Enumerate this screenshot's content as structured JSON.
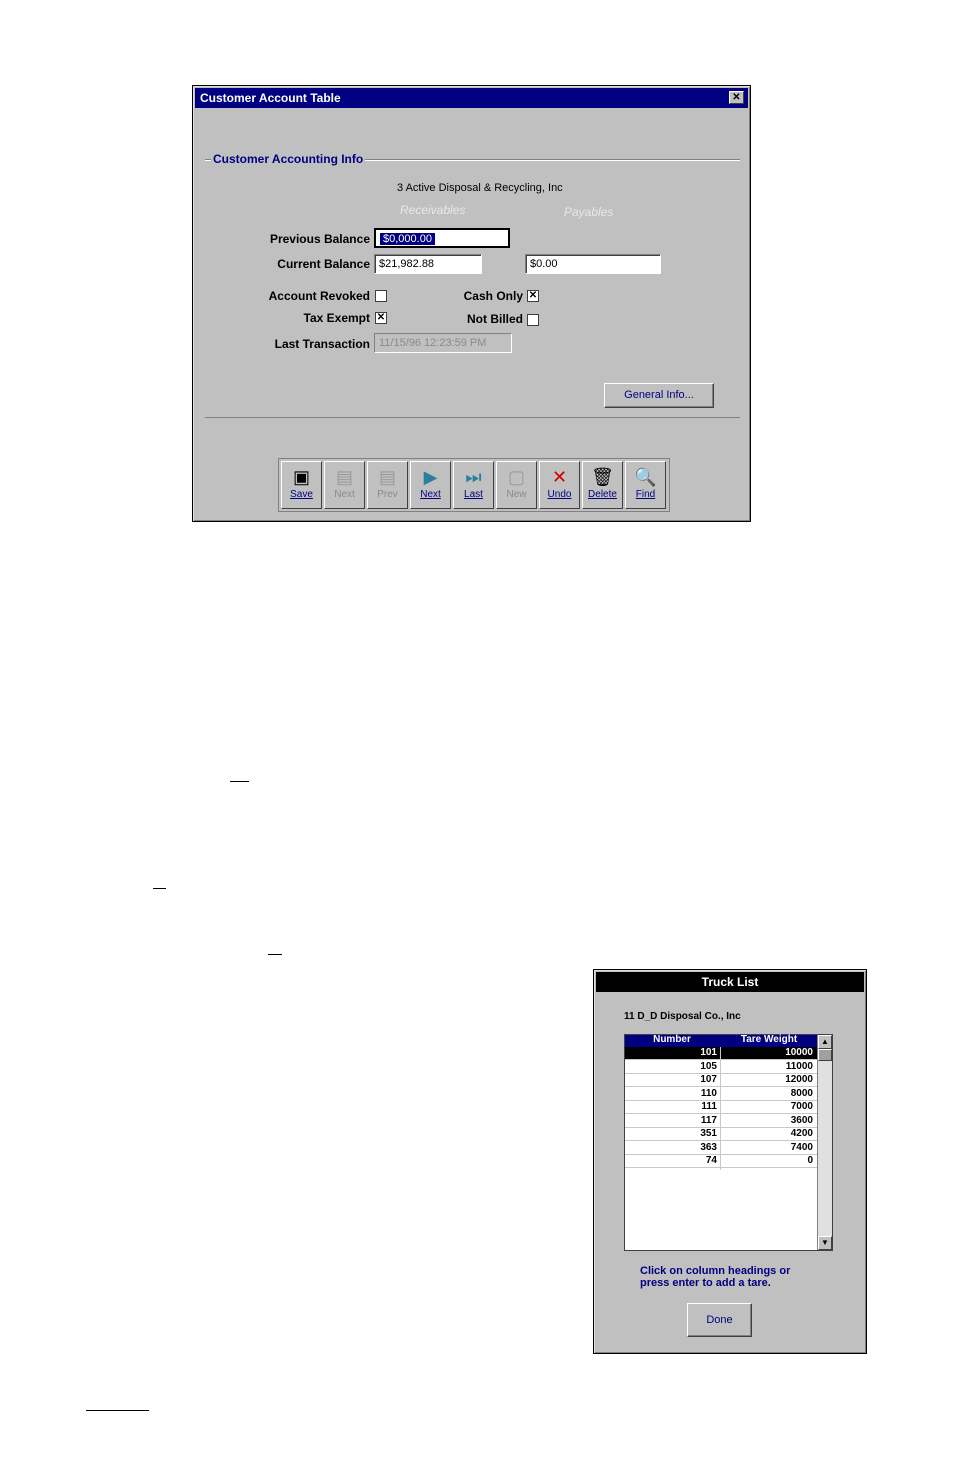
{
  "customer_window": {
    "title": "Customer Account Table",
    "group_label": "Customer Accounting Info",
    "customer_line": "3   Active Disposal & Recycling, Inc",
    "col_receivables": "Receivables",
    "col_payables": "Payables",
    "previous_balance_label": "Previous Balance",
    "previous_balance_value": "$0,000.00",
    "current_balance_label": "Current Balance",
    "current_balance_receivable": "$21,982.88",
    "current_balance_payable": "$0.00",
    "account_revoked_label": "Account Revoked",
    "cash_only_label": "Cash Only",
    "tax_exempt_label": "Tax Exempt",
    "not_billed_label": "Not Billed",
    "last_transaction_label": "Last Transaction",
    "last_transaction_value": "11/15/96 12:23:59 PM",
    "general_info_button": "General Info...",
    "toolbar": [
      {
        "label": "Save",
        "icon": "save-icon",
        "glyph": "▣",
        "enabled": true
      },
      {
        "label": "Next",
        "icon": "next-record-icon",
        "glyph": "▤",
        "enabled": false
      },
      {
        "label": "Prev",
        "icon": "prev-record-icon",
        "glyph": "▤",
        "enabled": false
      },
      {
        "label": "Next",
        "icon": "forward-icon",
        "glyph": "▶",
        "enabled": true
      },
      {
        "label": "Last",
        "icon": "last-icon",
        "glyph": "⏭",
        "enabled": true
      },
      {
        "label": "New",
        "icon": "new-icon",
        "glyph": "▢",
        "enabled": false
      },
      {
        "label": "Undo",
        "icon": "undo-icon",
        "glyph": "✕",
        "enabled": true
      },
      {
        "label": "Delete",
        "icon": "trash-icon",
        "glyph": "🗑",
        "enabled": true
      },
      {
        "label": "Find",
        "icon": "magnifier-icon",
        "glyph": "🔍",
        "enabled": true
      }
    ]
  },
  "truck_window": {
    "title": "Truck List",
    "customer_line": "11        D_D Disposal Co., Inc",
    "columns": [
      "Number",
      "Tare Weight"
    ],
    "rows": [
      [
        "101",
        "10000"
      ],
      [
        "105",
        "11000"
      ],
      [
        "107",
        "12000"
      ],
      [
        "110",
        "8000"
      ],
      [
        "111",
        "7000"
      ],
      [
        "117",
        "3600"
      ],
      [
        "351",
        "4200"
      ],
      [
        "363",
        "7400"
      ],
      [
        "74",
        "0"
      ]
    ],
    "hint": "Click on column headings or press enter to add a tare.",
    "done_button": "Done"
  },
  "colors": {
    "title_bar": "#000080",
    "dialog_face": "#c0c0c0",
    "selection": "#000080"
  }
}
